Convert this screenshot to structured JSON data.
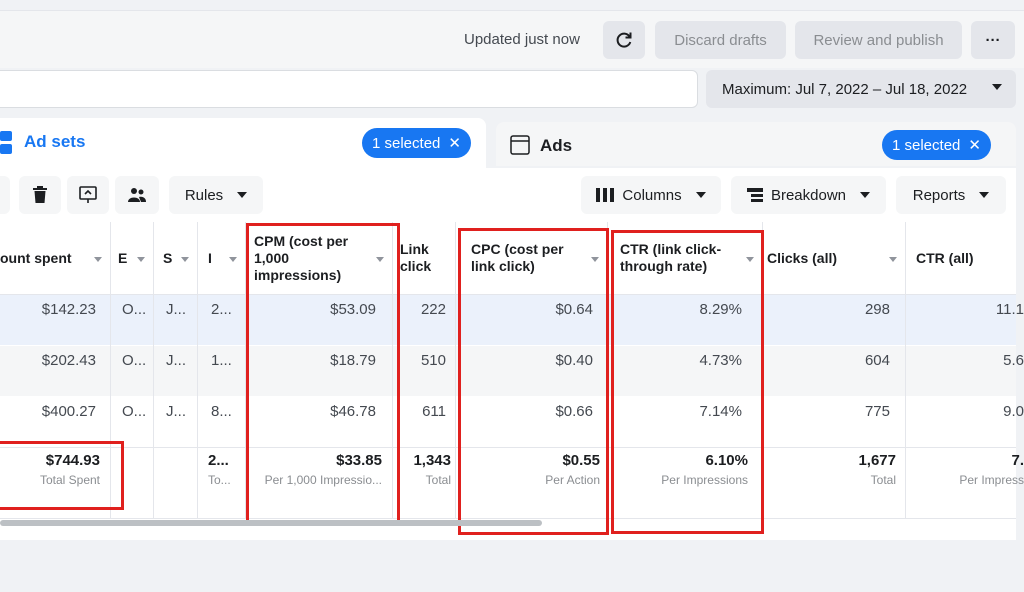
{
  "header": {
    "updated_text": "Updated just now",
    "discard_label": "Discard drafts",
    "review_label": "Review and publish",
    "more_label": "···",
    "date_range": "Maximum: Jul 7, 2022 – Jul 18, 2022"
  },
  "tabs": {
    "adsets": {
      "label": "Ad sets",
      "selected": "1 selected"
    },
    "ads": {
      "label": "Ads",
      "selected": "1 selected"
    }
  },
  "toolbar": {
    "rules_label": "Rules",
    "columns_label": "Columns",
    "breakdown_label": "Breakdown",
    "reports_label": "Reports"
  },
  "table": {
    "headers": {
      "amount_spent": "ount spent",
      "col_e": "E",
      "col_s": "S",
      "col_i": "I",
      "cpm": "CPM (cost per 1,000 impressions)",
      "link_clicks": "Link click",
      "cpc": "CPC (cost per link click)",
      "ctr_link": "CTR (link click-through rate)",
      "clicks_all": "Clicks (all)",
      "ctr_all": "CTR (all)"
    },
    "rows": [
      {
        "spent": "$142.23",
        "e": "O...",
        "s": "J...",
        "i": "2...",
        "cpm": "$53.09",
        "link": "222",
        "cpc": "$0.64",
        "ctr": "8.29%",
        "clicks": "298",
        "ctr_all": "11.1"
      },
      {
        "spent": "$202.43",
        "e": "O...",
        "s": "J...",
        "i": "1...",
        "cpm": "$18.79",
        "link": "510",
        "cpc": "$0.40",
        "ctr": "4.73%",
        "clicks": "604",
        "ctr_all": "5.6"
      },
      {
        "spent": "$400.27",
        "e": "O...",
        "s": "J...",
        "i": "8...",
        "cpm": "$46.78",
        "link": "611",
        "cpc": "$0.66",
        "ctr": "7.14%",
        "clicks": "775",
        "ctr_all": "9.0"
      }
    ],
    "totals": {
      "spent": "$744.93",
      "spent_sub": "Total Spent",
      "i": "2...",
      "i_sub": "To...",
      "cpm": "$33.85",
      "cpm_sub": "Per 1,000 Impressio...",
      "link": "1,343",
      "link_sub": "Total",
      "cpc": "$0.55",
      "cpc_sub": "Per Action",
      "ctr": "6.10%",
      "ctr_sub": "Per Impressions",
      "clicks": "1,677",
      "clicks_sub": "Total",
      "ctr_all": "7.",
      "ctr_all_sub": "Per Impress"
    }
  },
  "colors": {
    "accent": "#1877f2",
    "highlight_box": "#e0201e",
    "selected_row": "#ebf1fb"
  }
}
